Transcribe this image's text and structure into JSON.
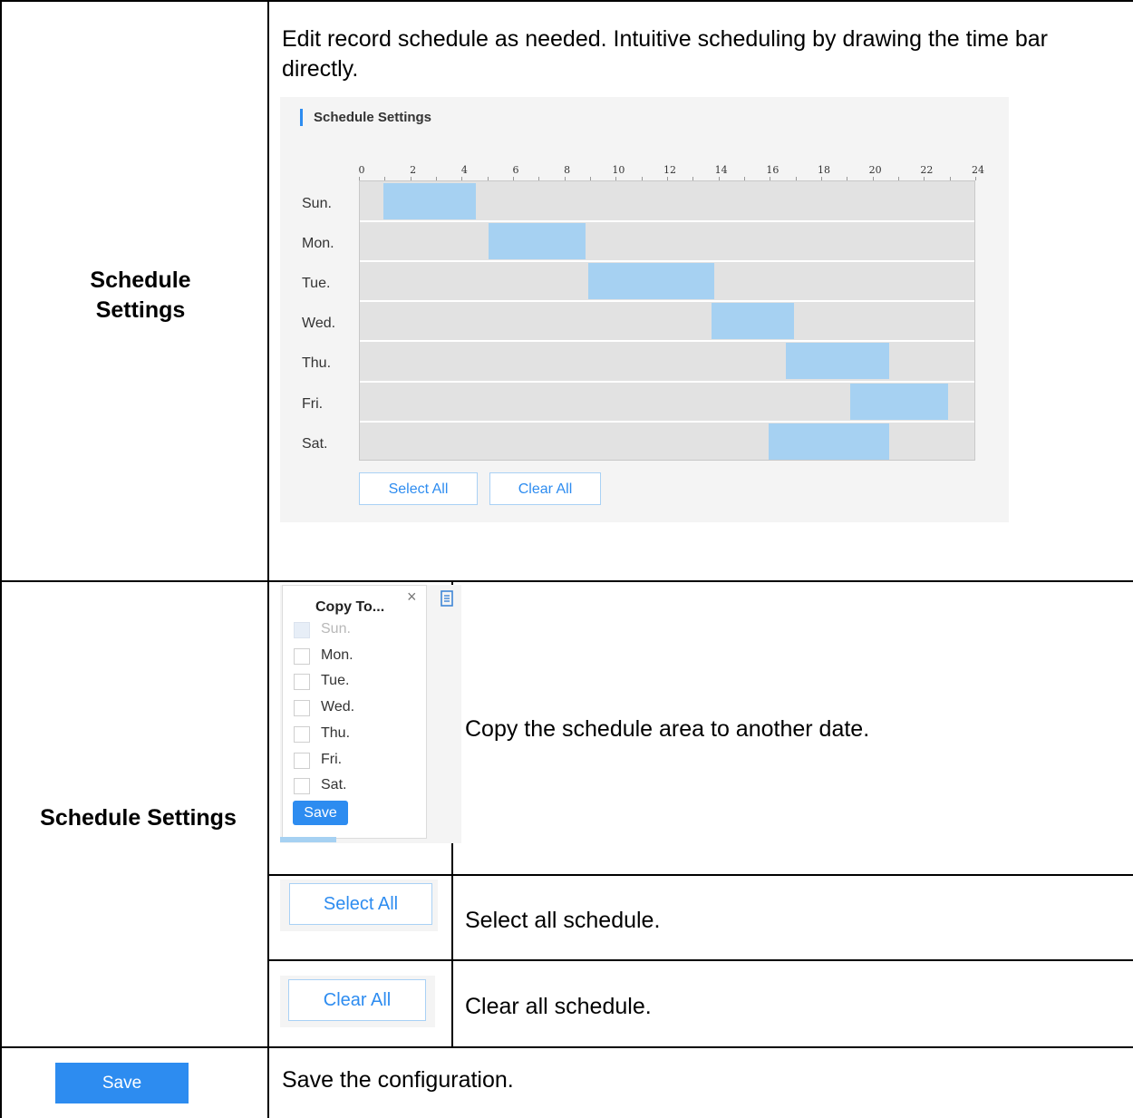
{
  "row1": {
    "title": "Schedule Settings",
    "description": "Edit record schedule as needed. Intuitive scheduling by drawing the time bar directly.",
    "panel": {
      "title": "Schedule Settings",
      "hours": [
        "0",
        "2",
        "4",
        "6",
        "8",
        "10",
        "12",
        "14",
        "16",
        "18",
        "20",
        "22",
        "24"
      ],
      "days": [
        {
          "label": "Sun.",
          "start": 0.9,
          "end": 4.5
        },
        {
          "label": "Mon.",
          "start": 5.0,
          "end": 8.8
        },
        {
          "label": "Tue.",
          "start": 8.9,
          "end": 13.8
        },
        {
          "label": "Wed.",
          "start": 13.7,
          "end": 16.9
        },
        {
          "label": "Thu.",
          "start": 16.6,
          "end": 20.6
        },
        {
          "label": "Fri.",
          "start": 19.1,
          "end": 22.9
        },
        {
          "label": "Sat.",
          "start": 15.9,
          "end": 20.6
        }
      ],
      "select_all": "Select All",
      "clear_all": "Clear All"
    }
  },
  "row2": {
    "title": "Schedule Settings",
    "copy_popup": {
      "title": "Copy To...",
      "close": "×",
      "days": [
        {
          "label": "Sun.",
          "disabled": true
        },
        {
          "label": "Mon.",
          "disabled": false
        },
        {
          "label": "Tue.",
          "disabled": false
        },
        {
          "label": "Wed.",
          "disabled": false
        },
        {
          "label": "Thu.",
          "disabled": false
        },
        {
          "label": "Fri.",
          "disabled": false
        },
        {
          "label": "Sat.",
          "disabled": false
        }
      ],
      "save": "Save"
    },
    "copy_desc": "Copy the schedule area to another date.",
    "select_all": "Select All",
    "select_desc": "Select all schedule.",
    "clear_all": "Clear All",
    "clear_desc": "Clear all schedule."
  },
  "row3": {
    "save": "Save",
    "save_desc": "Save the configuration."
  }
}
